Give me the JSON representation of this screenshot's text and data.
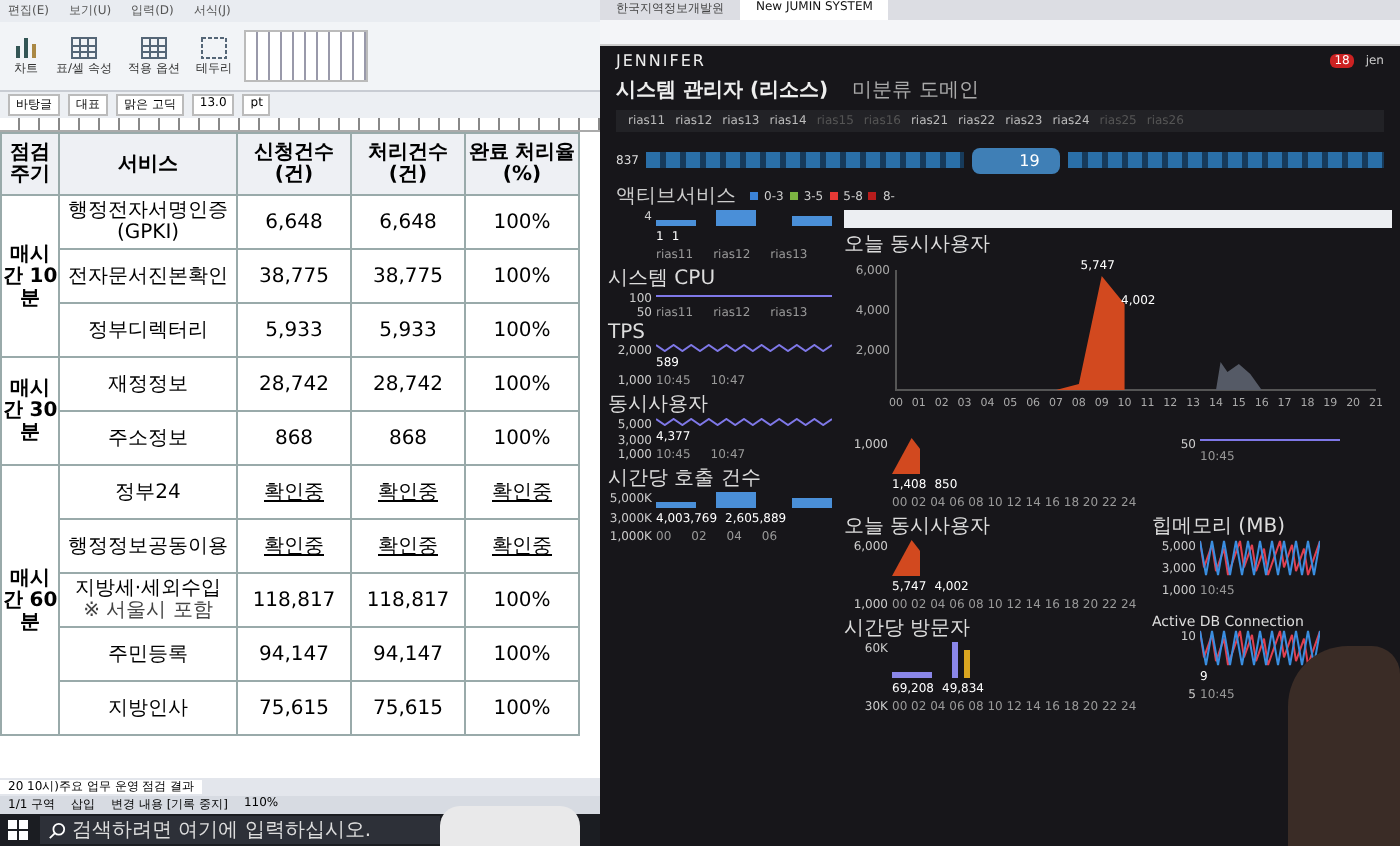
{
  "document_window": {
    "menu": [
      "편집(E)",
      "보기(U)",
      "입력(D)",
      "서식(J)"
    ],
    "ribbon_buttons": [
      {
        "label": "차트",
        "kind": "chart"
      },
      {
        "label": "표/셀 속성",
        "kind": "table"
      },
      {
        "label": "적용 옵션",
        "kind": "table"
      },
      {
        "label": "테두리",
        "kind": "border"
      }
    ],
    "format_bar": {
      "style": "바탕글",
      "paragraph": "대표",
      "font": "맑은 고딕",
      "size": "13.0",
      "unit": "pt"
    },
    "table": {
      "columns": [
        "점검 주기",
        "서비스",
        "신청건수(건)",
        "처리건수(건)",
        "완료 처리율(%)"
      ],
      "groups": [
        {
          "period": "매시간 10분",
          "rows": [
            {
              "service": "행정전자서명인증 (GPKI)",
              "note": "",
              "requested": "6,648",
              "processed": "6,648",
              "rate": "100%",
              "kind": "done"
            },
            {
              "service": "전자문서진본확인",
              "note": "",
              "requested": "38,775",
              "processed": "38,775",
              "rate": "100%",
              "kind": "done"
            },
            {
              "service": "정부디렉터리",
              "note": "",
              "requested": "5,933",
              "processed": "5,933",
              "rate": "100%",
              "kind": "done"
            }
          ]
        },
        {
          "period": "매시간 30분",
          "rows": [
            {
              "service": "재정정보",
              "note": "",
              "requested": "28,742",
              "processed": "28,742",
              "rate": "100%",
              "kind": "done"
            },
            {
              "service": "주소정보",
              "note": "",
              "requested": "868",
              "processed": "868",
              "rate": "100%",
              "kind": "done"
            }
          ]
        },
        {
          "period": "매시간 60분",
          "rows": [
            {
              "service": "정부24",
              "note": "",
              "requested": "확인중",
              "processed": "확인중",
              "rate": "확인중",
              "kind": "checking"
            },
            {
              "service": "행정정보공동이용",
              "note": "",
              "requested": "확인중",
              "processed": "확인중",
              "rate": "확인중",
              "kind": "checking"
            },
            {
              "service": "지방세·세외수입",
              "note": "※ 서울시 포함",
              "requested": "118,817",
              "processed": "118,817",
              "rate": "100%",
              "kind": "done"
            },
            {
              "service": "주민등록",
              "note": "",
              "requested": "94,147",
              "processed": "94,147",
              "rate": "100%",
              "kind": "done"
            },
            {
              "service": "지방인사",
              "note": "",
              "requested": "75,615",
              "processed": "75,615",
              "rate": "100%",
              "kind": "done"
            }
          ]
        }
      ]
    },
    "sheet_tab": "20 10시)주요 업무 운영 점검 결과",
    "status_bar": [
      "1/1 구역",
      "삽입",
      "변경 내용 [기록 중지]",
      "110%"
    ],
    "taskbar_search": {
      "placeholder": "검색하려면 여기에 입력하십시오."
    }
  },
  "dashboard": {
    "browser_tabs": [
      {
        "title": "한국지역정보개발원",
        "selected": false
      },
      {
        "title": "New JUMIN SYSTEM",
        "selected": true
      }
    ],
    "logo": "JENNIFER",
    "alert_count": "18",
    "user": "jen",
    "title": "시스템 관리자 (리소스)",
    "domain": "미분류 도메인",
    "instances": [
      {
        "name": "rias11",
        "active": true
      },
      {
        "name": "rias12",
        "active": true
      },
      {
        "name": "rias13",
        "active": true
      },
      {
        "name": "rias14",
        "active": true
      },
      {
        "name": "rias15",
        "active": false
      },
      {
        "name": "rias16",
        "active": false
      },
      {
        "name": "rias21",
        "active": true
      },
      {
        "name": "rias22",
        "active": true
      },
      {
        "name": "rias23",
        "active": true
      },
      {
        "name": "rias24",
        "active": true
      },
      {
        "name": "rias25",
        "active": false
      },
      {
        "name": "rias26",
        "active": false
      }
    ],
    "flow": {
      "left_count": "837",
      "center_count": "19"
    },
    "legend_title": "액티브서비스",
    "legend": [
      {
        "label": "0-3",
        "color": "#3b82d6"
      },
      {
        "label": "3-5",
        "color": "#7cb342"
      },
      {
        "label": "5-8",
        "color": "#e53935"
      },
      {
        "label": "8-",
        "color": "#b71c1c"
      }
    ],
    "side_panels": [
      {
        "kind": "bars",
        "y_ticks": [
          "4"
        ],
        "x_ticks": [
          "rias11",
          "rias12",
          "rias13"
        ],
        "labels": [
          "1",
          "1"
        ]
      },
      {
        "title": "시스템 CPU",
        "kind": "flat",
        "y_ticks": [
          "100",
          "50"
        ],
        "x_ticks": [
          "rias11",
          "rias12",
          "rias13"
        ]
      },
      {
        "title": "TPS",
        "kind": "line",
        "y_ticks": [
          "2,000",
          "1,000"
        ],
        "x_ticks": [
          "10:45",
          "10:47"
        ],
        "labels": [
          "589"
        ]
      },
      {
        "title": "동시사용자",
        "kind": "line",
        "y_ticks": [
          "5,000",
          "3,000",
          "1,000"
        ],
        "x_ticks": [
          "10:45",
          "10:47"
        ],
        "labels": [
          "4,377"
        ]
      },
      {
        "title": "시간당 호출 건수",
        "kind": "bars",
        "y_ticks": [
          "5,000K",
          "3,000K",
          "1,000K"
        ],
        "x_ticks": [
          "00",
          "02",
          "04",
          "06"
        ],
        "labels": [
          "4,003,769",
          "2,605,889"
        ]
      }
    ],
    "main_chart": {
      "chart_data": {
        "type": "area",
        "x": [
          "00",
          "01",
          "02",
          "03",
          "04",
          "05",
          "06",
          "07",
          "08",
          "09",
          "10",
          "11",
          "12",
          "13",
          "14",
          "15",
          "16",
          "17",
          "18",
          "19",
          "20",
          "21"
        ],
        "series": [
          {
            "name": "오늘 동시사용자",
            "color": "#d2491f",
            "values": [
              0,
              0,
              0,
              0,
              0,
              0,
              0,
              0,
              300,
              5700,
              4300,
              null,
              null,
              null,
              null,
              null,
              null,
              null,
              null,
              null,
              null,
              null
            ]
          }
        ],
        "ylim": [
          0,
          6000
        ],
        "yticks": [
          {
            "value": 2000,
            "label": "2,000"
          },
          {
            "value": 4000,
            "label": "4,000"
          },
          {
            "value": 6000,
            "label": "6,000"
          }
        ],
        "annotations": [
          "5,747",
          "4,002"
        ]
      }
    },
    "mini_panels": [
      {
        "kind": "area",
        "y_ticks": [
          "1,000"
        ],
        "x_ticks": [
          "00 02 04 06 08 10 12 14 16 18 20 22 24"
        ],
        "labels": [
          "1,408",
          "850"
        ]
      },
      {
        "kind": "flat",
        "y_ticks": [
          "50"
        ],
        "x_ticks": [
          "10:45"
        ]
      },
      {
        "title": "오늘 동시사용자",
        "kind": "area",
        "y_ticks": [
          "6,000",
          "1,000"
        ],
        "x_ticks": [
          "00 02 04 06 08 10 12 14 16 18 20 22 24"
        ],
        "labels": [
          "5,747",
          "4,002"
        ]
      },
      {
        "title": "힙메모리 (MB)",
        "kind": "noise",
        "y_ticks": [
          "5,000",
          "3,000",
          "1,000"
        ],
        "x_ticks": [
          "10:45"
        ]
      },
      {
        "title": "시간당 방문자",
        "kind": "bars",
        "y_ticks": [
          "60K",
          "30K"
        ],
        "x_ticks": [
          "00 02 04 06 08 10 12 14 16 18 20 22 24"
        ],
        "labels": [
          "69,208",
          "49,834"
        ]
      },
      {
        "title": "Active DB Connection",
        "kind": "noise",
        "y_ticks": [
          "10",
          "5"
        ],
        "x_ticks": [
          "10:45"
        ],
        "labels": [
          "9"
        ]
      }
    ]
  }
}
